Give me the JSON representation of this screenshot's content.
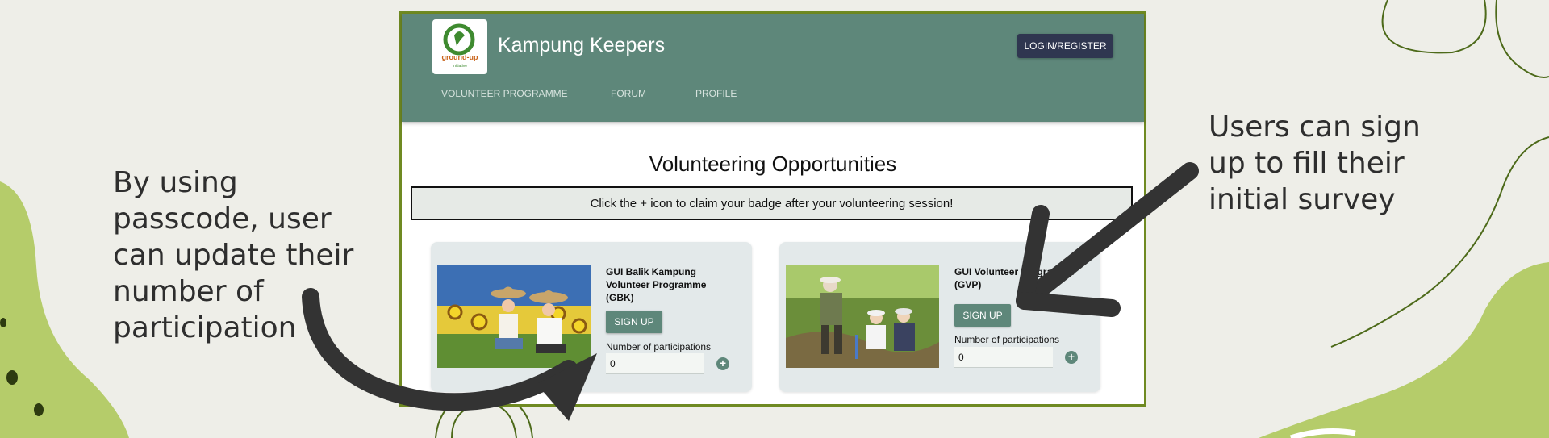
{
  "captions": {
    "left": "By using passcode, user can update their number of participation",
    "right": "Users can sign up to fill their initial survey"
  },
  "app": {
    "title": "Kampung Keepers",
    "logo_text": "ground-up initiative",
    "login_label": "LOGIN/REGISTER",
    "nav": [
      "VOLUNTEER PROGRAMME",
      "FORUM",
      "PROFILE"
    ]
  },
  "page": {
    "title": "Volunteering Opportunities",
    "notice": "Click the + icon to claim your badge after your volunteering session!"
  },
  "programmes": [
    {
      "title": "GUI Balik Kampung Volunteer Programme (GBK)",
      "signup_label": "SIGN UP",
      "participation_label": "Number of participations",
      "participation_value": "0"
    },
    {
      "title": "GUI Volunteer Programme (GVP)",
      "signup_label": "SIGN UP",
      "participation_label": "Number of participations",
      "participation_value": "0"
    }
  ],
  "colors": {
    "background": "#eeeee8",
    "header": "#5e877a",
    "frame_border": "#6f8a22",
    "login_button": "#2f3650",
    "decor_green": "#b5cc6a"
  }
}
